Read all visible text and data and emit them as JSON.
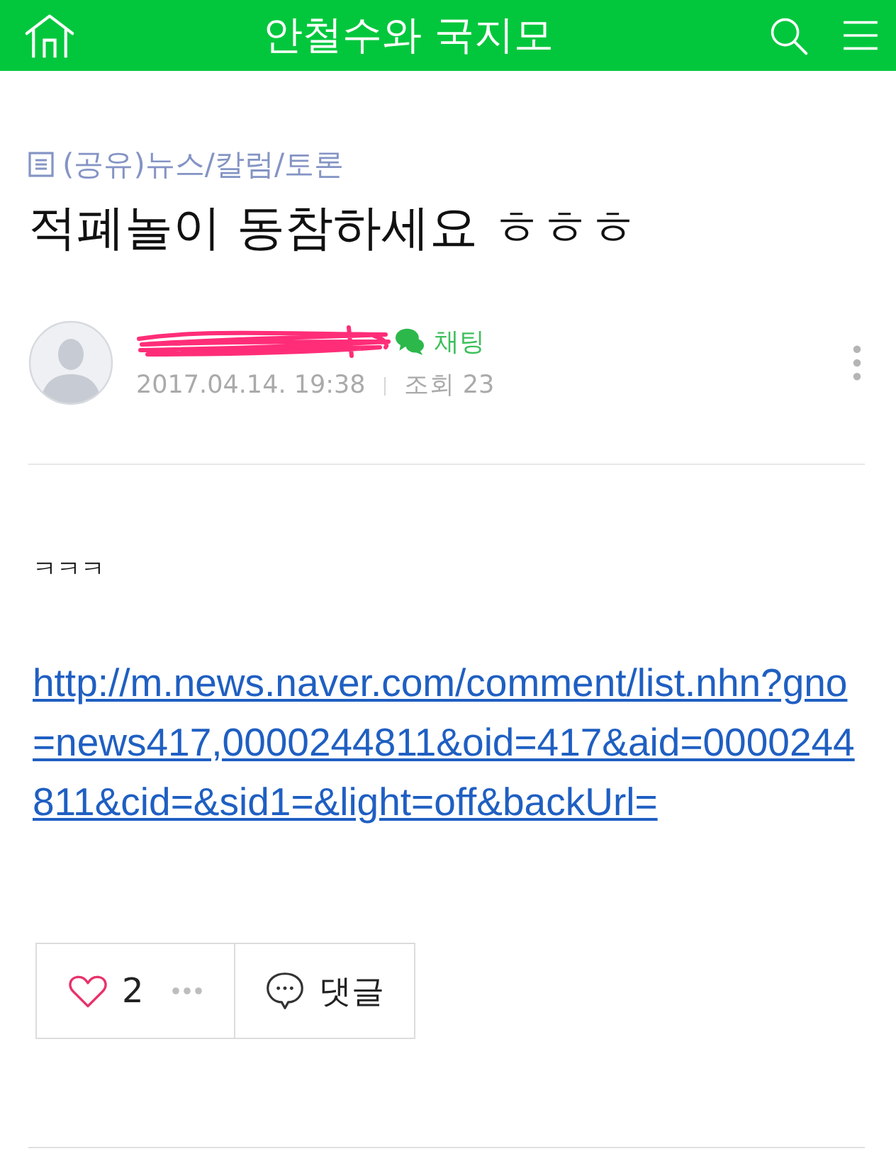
{
  "header": {
    "title": "안철수와 국지모"
  },
  "post": {
    "category": "(공유)뉴스/칼럼/토론",
    "title": "적폐놀이 동참하세요 ㅎㅎㅎ",
    "author": {
      "name_redacted": true,
      "chat_label": "채팅"
    },
    "date": "2017.04.14. 19:38",
    "views": "조회 23"
  },
  "body": [
    {
      "kind": "text",
      "text": "ㅋㅋㅋ"
    },
    {
      "kind": "link",
      "text": "http://m.news.naver.com/comment/list.nhn?gno=news417,0000244811&oid=417&aid=0000244811&cid=&sid1=&light=off&backUrl="
    }
  ],
  "actions": {
    "like": {
      "liked": false,
      "count": "2"
    },
    "comment": {
      "label": "댓글"
    }
  }
}
